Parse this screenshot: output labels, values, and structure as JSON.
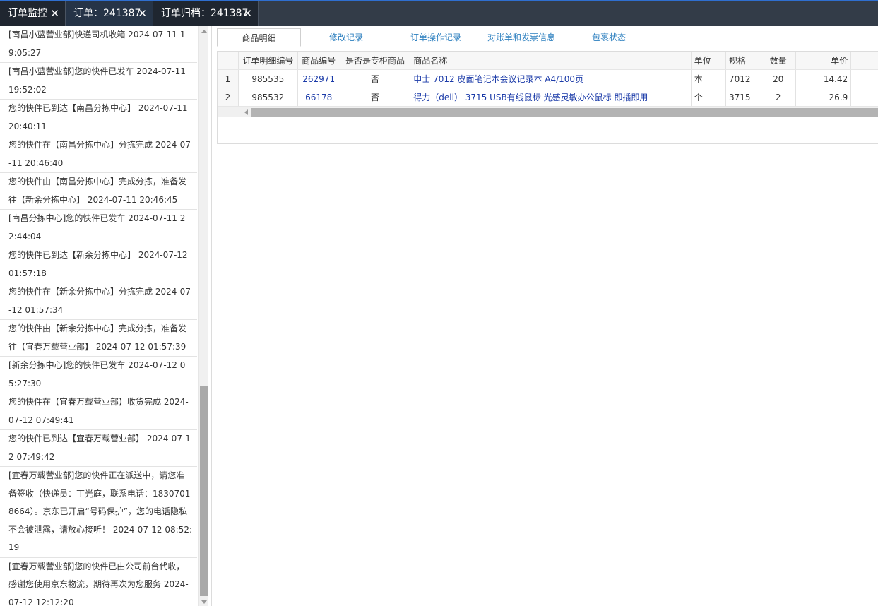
{
  "tabs": [
    {
      "label": "订单监控"
    },
    {
      "label": "订单：241387"
    },
    {
      "label": "订单归档：241387"
    }
  ],
  "close_glyph": "✕",
  "logistics_log": [
    "[南昌小蓝营业部]快递司机收箱 2024-07-11 19:05:27",
    "[南昌小蓝营业部]您的快件已发车 2024-07-11 19:52:02",
    "您的快件已到达【南昌分拣中心】 2024-07-11 20:40:11",
    "您的快件在【南昌分拣中心】分拣完成 2024-07-11 20:46:40",
    "您的快件由【南昌分拣中心】完成分拣，准备发往【新余分拣中心】 2024-07-11 20:46:45",
    "[南昌分拣中心]您的快件已发车 2024-07-11 22:44:04",
    "您的快件已到达【新余分拣中心】 2024-07-12 01:57:18",
    "您的快件在【新余分拣中心】分拣完成 2024-07-12 01:57:34",
    "您的快件由【新余分拣中心】完成分拣，准备发往【宜春万载营业部】 2024-07-12 01:57:39",
    "[新余分拣中心]您的快件已发车 2024-07-12 05:27:30",
    "您的快件在【宜春万载营业部】收货完成 2024-07-12 07:49:41",
    "您的快件已到达【宜春万载营业部】 2024-07-12 07:49:42",
    "[宜春万载营业部]您的快件正在派送中，请您准备签收（快递员：丁光庭，联系电话：18307018664）。京东已开启“号码保护”，您的电话隐私不会被泄露，请放心接听！ 2024-07-12 08:52:19",
    "[宜春万载营业部]您的快件已由公司前台代收，感谢您使用京东物流，期待再次为您服务 2024-07-12 12:12:20"
  ],
  "subtabs": [
    {
      "label": "商品明细"
    },
    {
      "label": "修改记录"
    },
    {
      "label": "订单操作记录"
    },
    {
      "label": "对账单和发票信息"
    },
    {
      "label": "包裹状态"
    }
  ],
  "table": {
    "columns": [
      "订单明细编号",
      "商品编号",
      "是否是专柜商品",
      "商品名称",
      "单位",
      "规格",
      "数量",
      "单价"
    ],
    "rows": [
      {
        "rownum": "1",
        "detail_id": "985535",
        "product_id": "262971",
        "is_counter": "否",
        "name": "申士 7012 皮面笔记本会议记录本 A4/100页",
        "unit": "本",
        "spec": "7012",
        "qty": "20",
        "price": "14.42"
      },
      {
        "rownum": "2",
        "detail_id": "985532",
        "product_id": "66178",
        "is_counter": "否",
        "name": "得力（deli） 3715 USB有线鼠标 光感灵敏办公鼠标 即插即用",
        "unit": "个",
        "spec": "3715",
        "qty": "2",
        "price": "26.9"
      }
    ]
  }
}
